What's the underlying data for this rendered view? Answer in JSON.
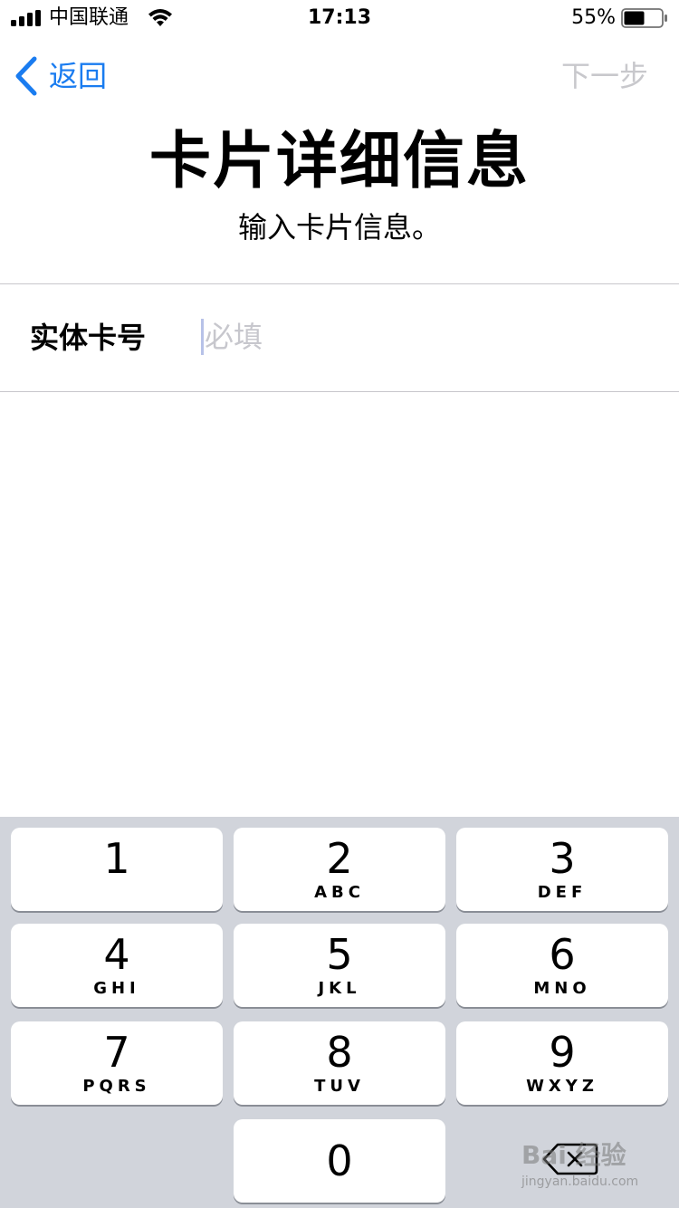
{
  "status_bar": {
    "carrier": "中国联通",
    "time": "17:13",
    "battery_percent": "55%",
    "battery_level": 0.55,
    "icons": [
      "signal-icon",
      "wifi-icon",
      "battery-icon"
    ]
  },
  "nav": {
    "back_label": "返回",
    "next_label": "下一步",
    "back_color": "#1a7cf0",
    "next_color": "#c8c8cc"
  },
  "header": {
    "title": "卡片详细信息",
    "subtitle": "输入卡片信息。"
  },
  "form": {
    "card_number_label": "实体卡号",
    "card_number_placeholder": "必填",
    "card_number_value": ""
  },
  "keypad": {
    "keys": [
      {
        "num": "1",
        "letters": ""
      },
      {
        "num": "2",
        "letters": "ABC"
      },
      {
        "num": "3",
        "letters": "DEF"
      },
      {
        "num": "4",
        "letters": "GHI"
      },
      {
        "num": "5",
        "letters": "JKL"
      },
      {
        "num": "6",
        "letters": "MNO"
      },
      {
        "num": "7",
        "letters": "PQRS"
      },
      {
        "num": "8",
        "letters": "TUV"
      },
      {
        "num": "9",
        "letters": "WXYZ"
      },
      {
        "num": "0",
        "letters": ""
      }
    ],
    "backspace_icon": "backspace-icon",
    "background_color": "#d1d4db"
  },
  "watermark": {
    "logo_text": "Bai 经验",
    "url": "jingyan.baidu.com"
  }
}
